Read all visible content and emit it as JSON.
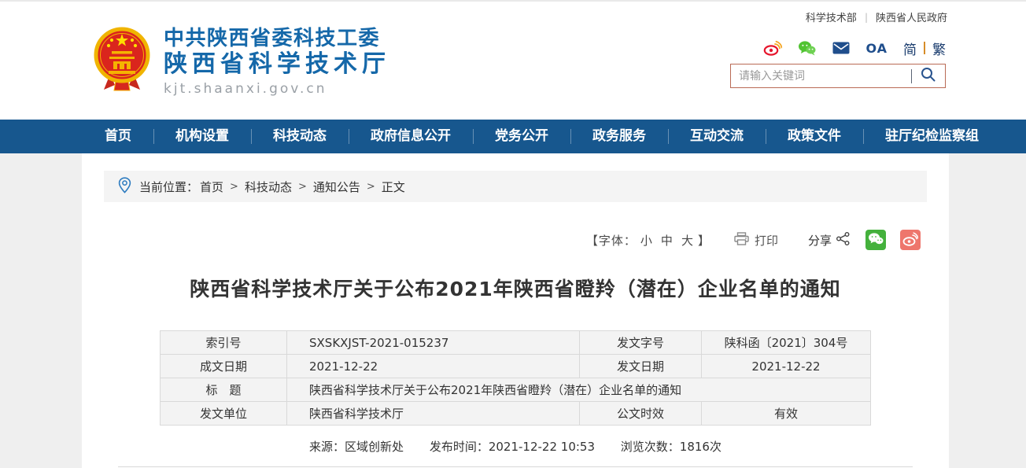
{
  "colors": {
    "nav_blue": "#17578e",
    "title_blue": "#1568a9",
    "search_border_red": "#b96a55",
    "wechat_green": "#44b13c",
    "weibo_red": "#ee766c",
    "breadcrumb_bg": "#f4f4f4",
    "table_bg": "#f3f3f3"
  },
  "top_bar": {
    "link1": "科学技术部",
    "divider": "|",
    "link2": "陕西省人民政府"
  },
  "header": {
    "org_line1": "中共陕西省委科技工委",
    "org_line2": "陕西省科学技术厅",
    "site_url": "kjt.shaanxi.gov.cn",
    "oa_label": "OA",
    "lang_simplified": "简",
    "lang_traditional": "繁",
    "search": {
      "placeholder": "请输入关键词"
    },
    "icons": [
      "weibo-icon",
      "wechat-icon",
      "mail-icon",
      "search-icon",
      "national-emblem"
    ]
  },
  "nav": {
    "items": [
      "首页",
      "机构设置",
      "科技动态",
      "政府信息公开",
      "党务公开",
      "政务服务",
      "互动交流",
      "政策文件",
      "驻厅纪检监察组"
    ]
  },
  "breadcrumb": {
    "label": "当前位置：",
    "separator": ">",
    "items": [
      "首页",
      "科技动态",
      "通知公告",
      "正文"
    ]
  },
  "toolbar": {
    "font_open": "【字体：",
    "font_small": "小",
    "font_medium": "中",
    "font_large": "大",
    "font_close": "】",
    "print_label": "打印",
    "share_label": "分享"
  },
  "article": {
    "title": "陕西省科学技术厅关于公布2021年陕西省瞪羚（潜在）企业名单的通知",
    "table": {
      "rows": [
        [
          "索引号",
          "SXSKXJST-2021-015237",
          "发文字号",
          "陕科函〔2021〕304号"
        ],
        [
          "成文日期",
          "2021-12-22",
          "发文日期",
          "2021-12-22"
        ],
        [
          "标　题",
          "陕西省科学技术厅关于公布2021年陕西省瞪羚（潜在）企业名单的通知"
        ],
        [
          "发文单位",
          "陕西省科学技术厅",
          "公文时效",
          "有效"
        ]
      ]
    },
    "source_label": "来源：",
    "source_value": "区域创新处",
    "time_label": "发布时间：",
    "time_value": "2021-12-22 10:53",
    "views_label": "浏览次数：",
    "views_value": "1816次"
  }
}
